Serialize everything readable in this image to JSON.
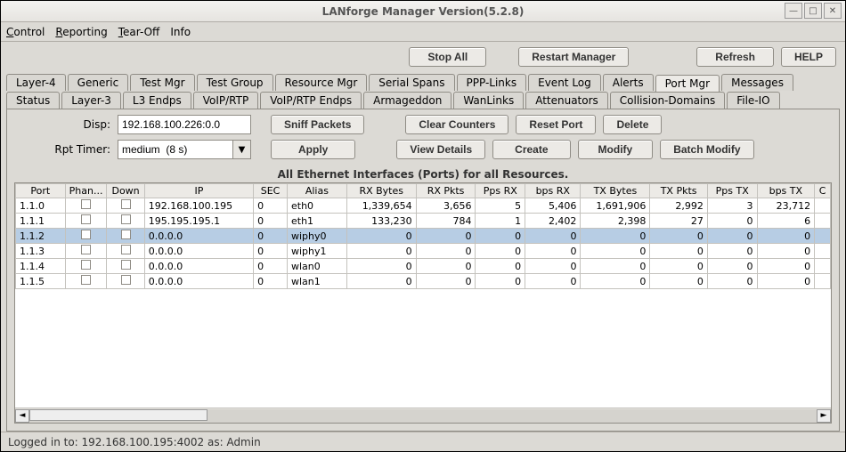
{
  "window": {
    "title": "LANforge Manager    Version(5.2.8)"
  },
  "menu": {
    "control": "Control",
    "reporting": "Reporting",
    "tearoff": "Tear-Off",
    "info": "Info"
  },
  "topbar": {
    "stop_all": "Stop All",
    "restart_manager": "Restart Manager",
    "refresh": "Refresh",
    "help": "HELP"
  },
  "tabs_row1": [
    "Layer-4",
    "Generic",
    "Test Mgr",
    "Test Group",
    "Resource Mgr",
    "Serial Spans",
    "PPP-Links",
    "Event Log",
    "Alerts",
    "Port Mgr",
    "Messages"
  ],
  "tabs_row2": [
    "Status",
    "Layer-3",
    "L3 Endps",
    "VoIP/RTP",
    "VoIP/RTP Endps",
    "Armageddon",
    "WanLinks",
    "Attenuators",
    "Collision-Domains",
    "File-IO"
  ],
  "active_tab": "Port Mgr",
  "controls": {
    "disp_label": "Disp:",
    "disp_value": "192.168.100.226:0.0",
    "sniff": "Sniff Packets",
    "clear_counters": "Clear Counters",
    "reset_port": "Reset Port",
    "delete": "Delete",
    "rpt_label": "Rpt Timer:",
    "rpt_value": "medium  (8 s)",
    "apply": "Apply",
    "view_details": "View Details",
    "create": "Create",
    "modify": "Modify",
    "batch_modify": "Batch Modify"
  },
  "grid": {
    "title": "All Ethernet Interfaces (Ports) for all Resources.",
    "headers": [
      "Port",
      "Phan...",
      "Down",
      "IP",
      "SEC",
      "Alias",
      "RX Bytes",
      "RX Pkts",
      "Pps RX",
      "bps RX",
      "TX Bytes",
      "TX Pkts",
      "Pps TX",
      "bps TX",
      "C"
    ],
    "rows": [
      {
        "port": "1.1.0",
        "phantom": false,
        "down": false,
        "ip": "192.168.100.195",
        "sec": "0",
        "alias": "eth0",
        "rx_bytes": "1,339,654",
        "rx_pkts": "3,656",
        "pps_rx": "5",
        "bps_rx": "5,406",
        "tx_bytes": "1,691,906",
        "tx_pkts": "2,992",
        "pps_tx": "3",
        "bps_tx": "23,712",
        "selected": false
      },
      {
        "port": "1.1.1",
        "phantom": false,
        "down": false,
        "ip": "195.195.195.1",
        "sec": "0",
        "alias": "eth1",
        "rx_bytes": "133,230",
        "rx_pkts": "784",
        "pps_rx": "1",
        "bps_rx": "2,402",
        "tx_bytes": "2,398",
        "tx_pkts": "27",
        "pps_tx": "0",
        "bps_tx": "6",
        "selected": false
      },
      {
        "port": "1.1.2",
        "phantom": false,
        "down": false,
        "ip": "0.0.0.0",
        "sec": "0",
        "alias": "wiphy0",
        "rx_bytes": "0",
        "rx_pkts": "0",
        "pps_rx": "0",
        "bps_rx": "0",
        "tx_bytes": "0",
        "tx_pkts": "0",
        "pps_tx": "0",
        "bps_tx": "0",
        "selected": true
      },
      {
        "port": "1.1.3",
        "phantom": false,
        "down": false,
        "ip": "0.0.0.0",
        "sec": "0",
        "alias": "wiphy1",
        "rx_bytes": "0",
        "rx_pkts": "0",
        "pps_rx": "0",
        "bps_rx": "0",
        "tx_bytes": "0",
        "tx_pkts": "0",
        "pps_tx": "0",
        "bps_tx": "0",
        "selected": false
      },
      {
        "port": "1.1.4",
        "phantom": false,
        "down": false,
        "ip": "0.0.0.0",
        "sec": "0",
        "alias": "wlan0",
        "rx_bytes": "0",
        "rx_pkts": "0",
        "pps_rx": "0",
        "bps_rx": "0",
        "tx_bytes": "0",
        "tx_pkts": "0",
        "pps_tx": "0",
        "bps_tx": "0",
        "selected": false
      },
      {
        "port": "1.1.5",
        "phantom": false,
        "down": false,
        "ip": "0.0.0.0",
        "sec": "0",
        "alias": "wlan1",
        "rx_bytes": "0",
        "rx_pkts": "0",
        "pps_rx": "0",
        "bps_rx": "0",
        "tx_bytes": "0",
        "tx_pkts": "0",
        "pps_tx": "0",
        "bps_tx": "0",
        "selected": false
      }
    ]
  },
  "statusbar": {
    "text": "Logged in to:  192.168.100.195:4002  as:  Admin"
  }
}
